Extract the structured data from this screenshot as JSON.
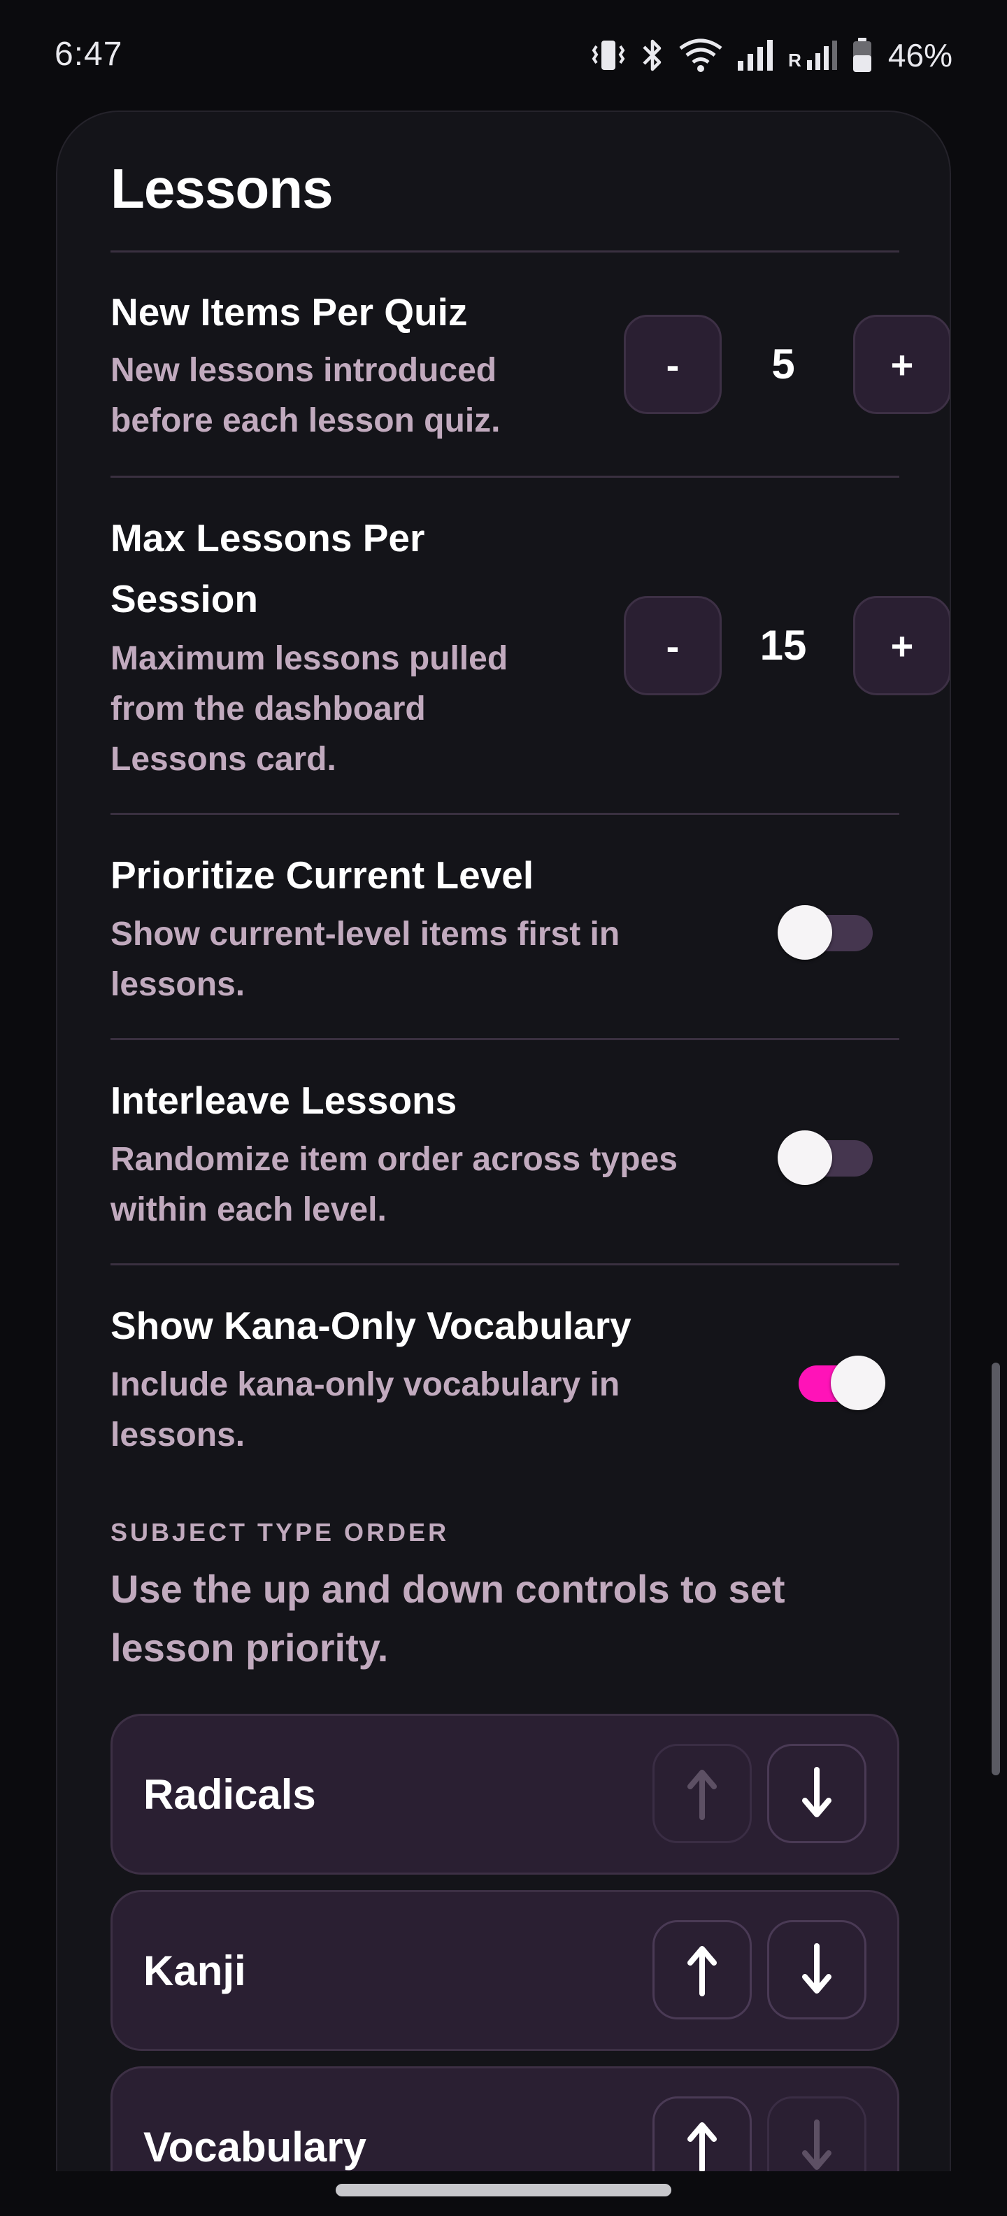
{
  "status_bar": {
    "time": "6:47",
    "battery_percent": "46%",
    "icons": [
      "vibrate-icon",
      "bluetooth-icon",
      "wifi-icon",
      "signal-icon",
      "roaming-signal-icon",
      "battery-icon"
    ],
    "roaming_label": "R"
  },
  "lessons": {
    "title": "Lessons",
    "new_items_per_quiz": {
      "title": "New Items Per Quiz",
      "description": [
        "New lessons introduced",
        "before each lesson quiz."
      ],
      "value": "5",
      "decrement_label": "-",
      "increment_label": "+"
    },
    "max_lessons_per_session": {
      "title": [
        "Max Lessons Per",
        "Session"
      ],
      "description": [
        "Maximum lessons pulled",
        "from the dashboard",
        "Lessons card."
      ],
      "value": "15",
      "decrement_label": "-",
      "increment_label": "+"
    },
    "prioritize_current_level": {
      "title": "Prioritize Current Level",
      "description": [
        "Show current-level items first in",
        "lessons."
      ],
      "enabled": false
    },
    "interleave_lessons": {
      "title": "Interleave Lessons",
      "description": [
        "Randomize item order across types",
        "within each level."
      ],
      "enabled": false
    },
    "show_kana_only_vocabulary": {
      "title": "Show Kana-Only Vocabulary",
      "description": [
        "Include kana-only vocabulary in",
        "lessons."
      ],
      "enabled": true
    },
    "subject_type_order": {
      "label": "SUBJECT TYPE ORDER",
      "help": [
        "Use the up and down controls to set",
        "lesson priority."
      ],
      "items": [
        {
          "label": "Radicals",
          "up_enabled": false,
          "down_enabled": true
        },
        {
          "label": "Kanji",
          "up_enabled": true,
          "down_enabled": true
        },
        {
          "label": "Vocabulary",
          "up_enabled": true,
          "down_enabled": false
        }
      ]
    }
  },
  "colors": {
    "background": "#0b0b0e",
    "card": "#141419",
    "accent_pink": "#ff13b8",
    "muted_text": "#c1aabe",
    "button_fill": "#2a1f32"
  }
}
